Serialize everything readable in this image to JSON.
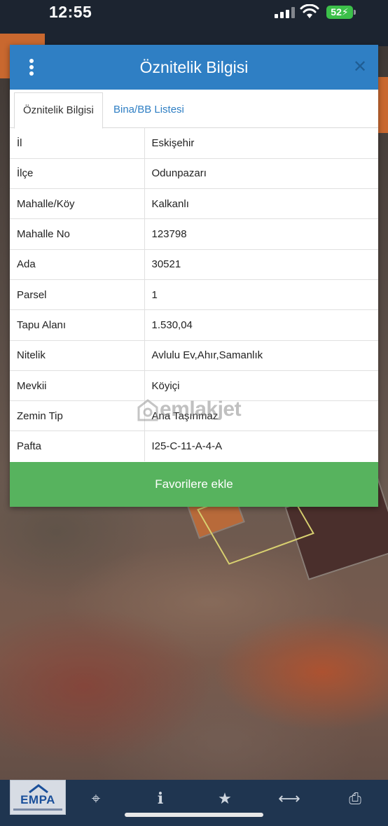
{
  "status_bar": {
    "time": "12:55",
    "battery": "52"
  },
  "dialog": {
    "title": "Öznitelik Bilgisi",
    "tabs": [
      {
        "label": "Öznitelik Bilgisi",
        "active": true
      },
      {
        "label": "Bina/BB Listesi",
        "active": false
      }
    ],
    "rows": [
      {
        "key": "İl",
        "value": "Eskişehir"
      },
      {
        "key": "İlçe",
        "value": "Odunpazarı"
      },
      {
        "key": "Mahalle/Köy",
        "value": "Kalkanlı"
      },
      {
        "key": "Mahalle No",
        "value": "123798"
      },
      {
        "key": "Ada",
        "value": "30521"
      },
      {
        "key": "Parsel",
        "value": "1"
      },
      {
        "key": "Tapu Alanı",
        "value": "1.530,04"
      },
      {
        "key": "Nitelik",
        "value": "Avlulu Ev,Ahır,Samanlık"
      },
      {
        "key": "Mevkii",
        "value": "Köyiçi"
      },
      {
        "key": "Zemin Tip",
        "value": "Ana Taşınmaz"
      },
      {
        "key": "Pafta",
        "value": "I25-C-11-A-4-A"
      }
    ],
    "favorite_button": "Favorilere ekle"
  },
  "watermark": "emlakjet",
  "bottom_bar": {
    "logo_text": "EMPA",
    "icons": [
      "locate-icon",
      "info-icon",
      "star-icon",
      "measure-icon",
      "print-icon"
    ]
  },
  "colors": {
    "header": "#2f7fc4",
    "favorite_button": "#57b35e",
    "bottom_bar": "#1f3550"
  }
}
